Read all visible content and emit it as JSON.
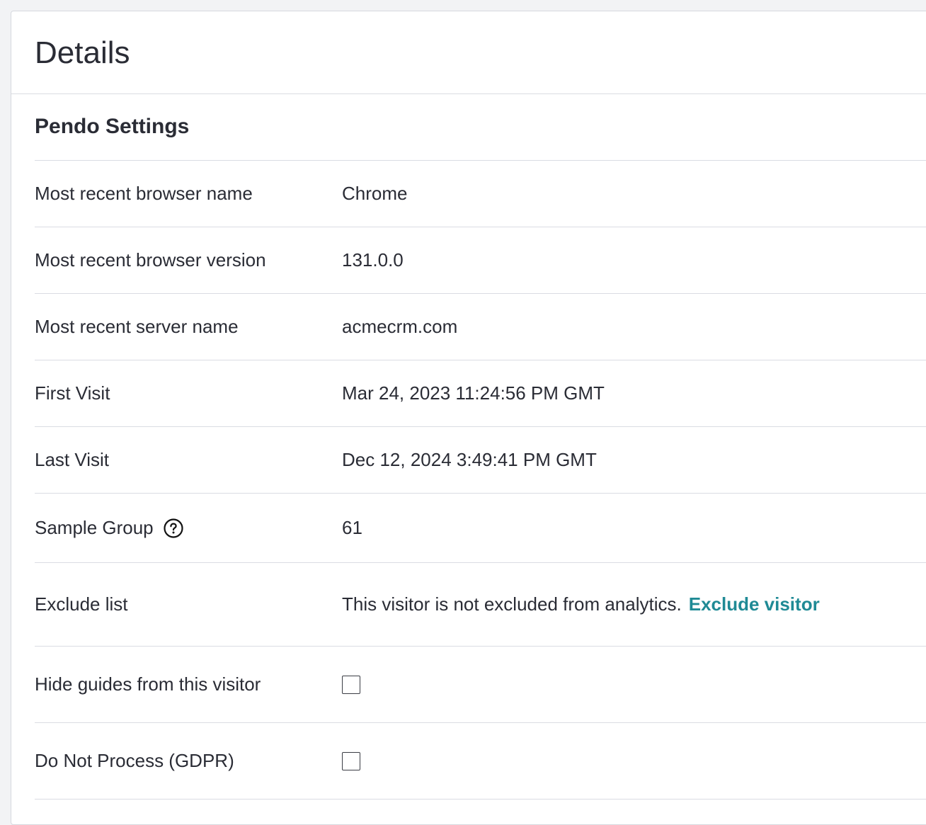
{
  "card": {
    "title": "Details"
  },
  "section": {
    "title": "Pendo Settings"
  },
  "rows": {
    "browser_name": {
      "label": "Most recent browser name",
      "value": "Chrome"
    },
    "browser_version": {
      "label": "Most recent browser version",
      "value": "131.0.0"
    },
    "server_name": {
      "label": "Most recent server name",
      "value": "acmecrm.com"
    },
    "first_visit": {
      "label": "First Visit",
      "value": "Mar 24, 2023 11:24:56 PM GMT"
    },
    "last_visit": {
      "label": "Last Visit",
      "value": "Dec 12, 2024 3:49:41 PM GMT"
    },
    "sample_group": {
      "label": "Sample Group",
      "value": "61",
      "icon": "help-circle-icon"
    },
    "exclude_list": {
      "label": "Exclude list",
      "value": "This visitor is not excluded from analytics.",
      "link": "Exclude visitor"
    },
    "hide_guides": {
      "label": "Hide guides from this visitor",
      "checked": false
    },
    "do_not_process": {
      "label": "Do Not Process (GDPR)",
      "checked": false
    }
  },
  "colors": {
    "link": "#1f8a95",
    "divider": "#dadce3",
    "text": "#2a2c35"
  }
}
